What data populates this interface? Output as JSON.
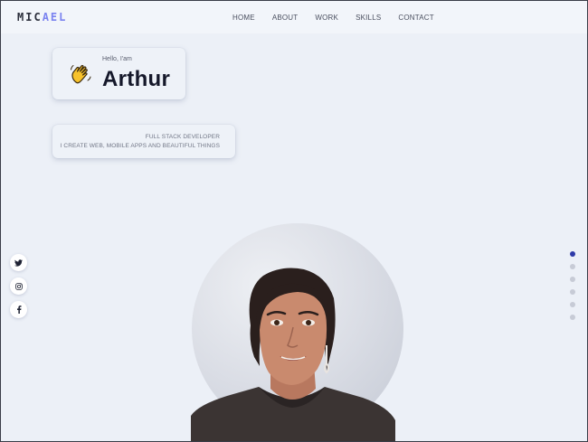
{
  "header": {
    "logo_part1": "MIC",
    "logo_part2": "AEL",
    "nav": [
      "HOME",
      "ABOUT",
      "WORK",
      "SKILLS",
      "CONTACT"
    ]
  },
  "hero": {
    "greeting": "Hello, I'am",
    "name": "Arthur",
    "role_line1": "FULL STACK DEVELOPER",
    "role_line2": "I CREATE WEB, MOBILE APPS AND BEAUTIFUL THINGS"
  },
  "social": [
    {
      "icon": "twitter-icon"
    },
    {
      "icon": "instagram-icon"
    },
    {
      "icon": "facebook-icon"
    }
  ],
  "section_dots": {
    "count": 6,
    "active_index": 0
  },
  "colors": {
    "background": "#ecf0f7",
    "accent": "#7b83f0",
    "active_dot": "#2e3aa8"
  }
}
